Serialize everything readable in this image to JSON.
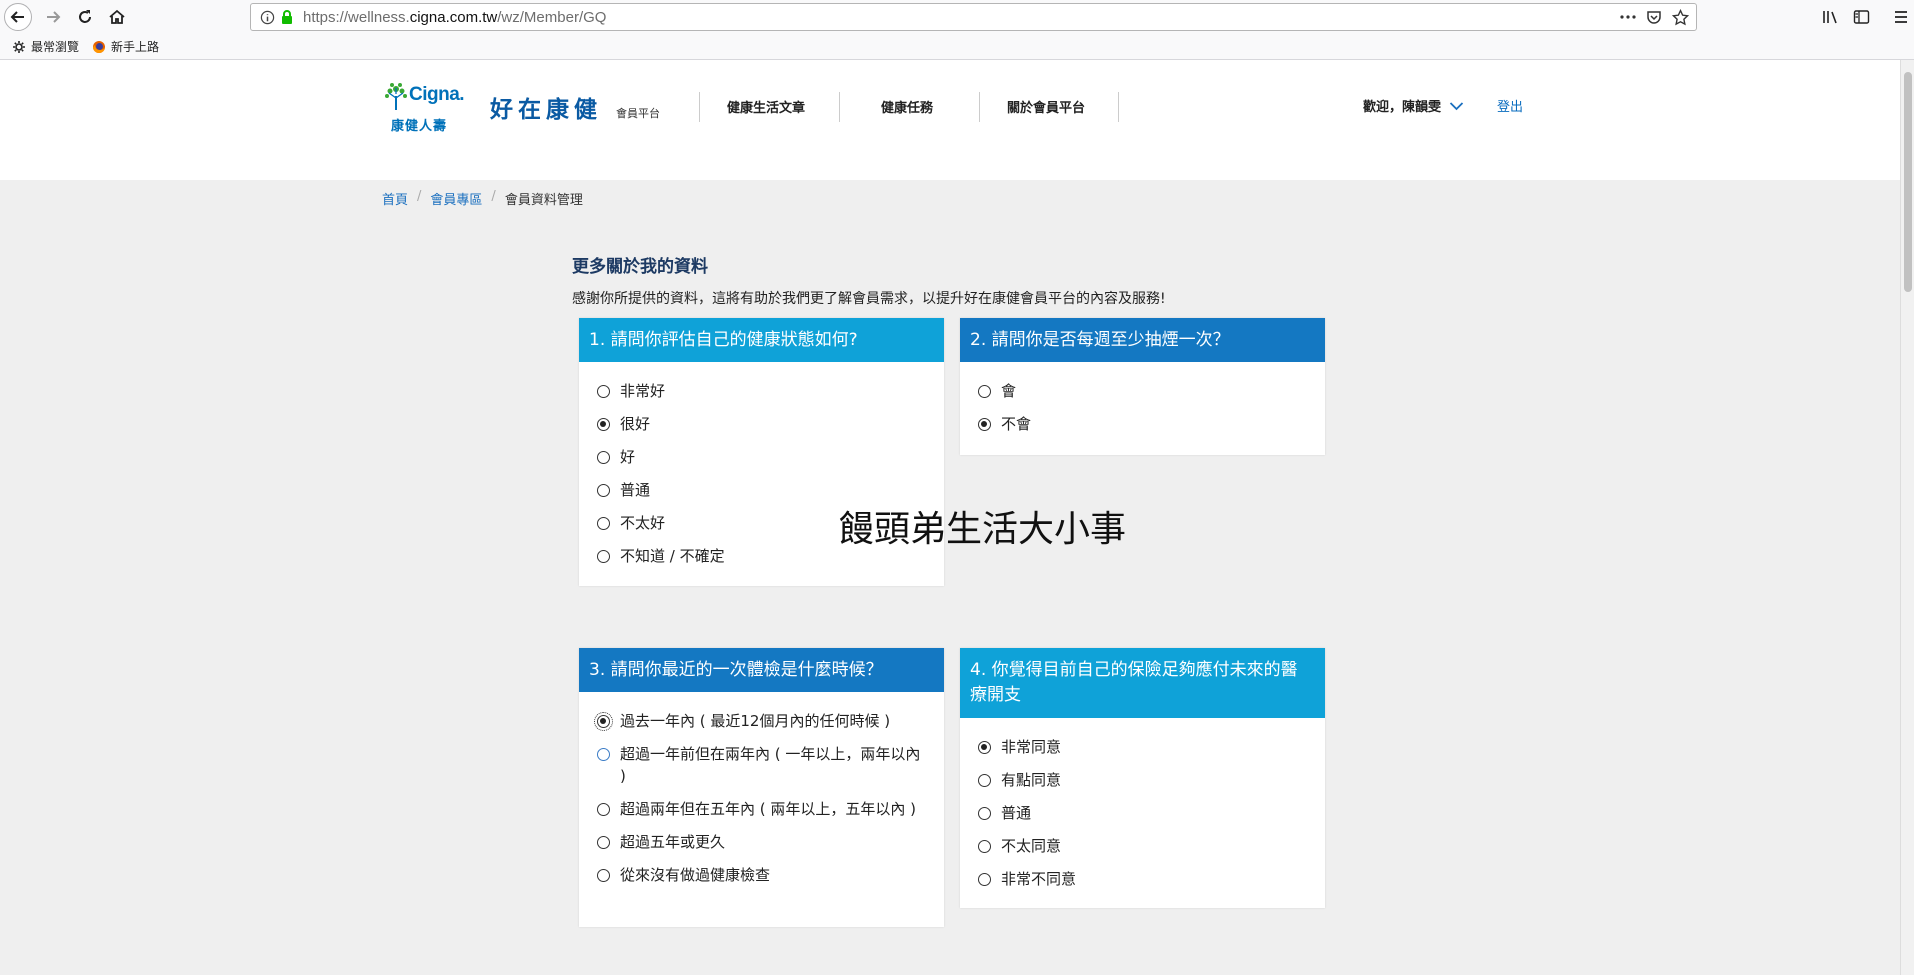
{
  "browser": {
    "url_prefix": "https://wellness.",
    "url_domain": "cigna.com.tw",
    "url_path": "/wz/Member/GQ",
    "bookmarks": [
      "最常瀏覽",
      "新手上路"
    ]
  },
  "header": {
    "logo_brand": "Cigna.",
    "logo_cn": "康健人壽",
    "site_name": "好在康健",
    "site_sub": "會員平台",
    "nav": [
      "健康生活文章",
      "健康任務",
      "關於會員平台"
    ],
    "welcome": "歡迎，陳韻雯",
    "logout": "登出"
  },
  "breadcrumb": {
    "items": [
      "首頁",
      "會員專區"
    ],
    "current": "會員資料管理",
    "separator": "/"
  },
  "main": {
    "title": "更多關於我的資料",
    "intro": "感謝你所提供的資料，這將有助於我們更了解會員需求，以提升好在康健會員平台的內容及服務!",
    "questions": [
      {
        "title": "1. 請問你評估自己的健康狀態如何?",
        "options": [
          "非常好",
          "很好",
          "好",
          "普通",
          "不太好",
          "不知道 / 不確定"
        ],
        "selected": 1
      },
      {
        "title": "2. 請問你是否每週至少抽煙一次？",
        "options": [
          "會",
          "不會"
        ],
        "selected": 1
      },
      {
        "title": "3. 請問你最近的一次體檢是什麼時候？",
        "options": [
          "過去一年內 ( 最近12個月內的任何時候 )",
          "超過一年前但在兩年內 ( 一年以上，兩年以內 )",
          "超過兩年但在五年內 ( 兩年以上，五年以內 )",
          "超過五年或更久",
          "從來沒有做過健康檢查"
        ],
        "selected": 0
      },
      {
        "title": "4. 你覺得目前自己的保險足夠應付未來的醫療開支",
        "options": [
          "非常同意",
          "有點同意",
          "普通",
          "不太同意",
          "非常不同意"
        ],
        "selected": 0
      }
    ]
  },
  "watermark": "饅頭弟生活大小事",
  "colors": {
    "header_blue": "#0fa2d8",
    "header_blue_dark": "#1478c2",
    "link_blue": "#1a6fbf",
    "brand_blue": "#0a5aa3"
  }
}
